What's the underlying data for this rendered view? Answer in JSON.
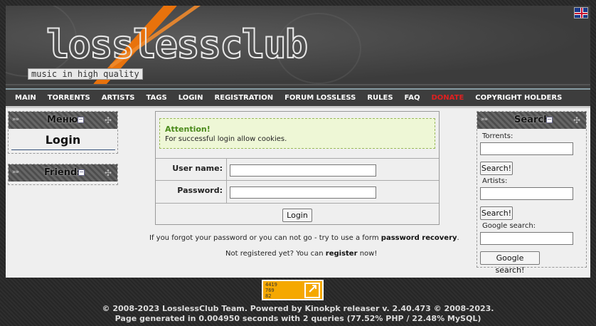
{
  "header": {
    "logo_text": "losslessclub",
    "tagline": "music in high quality"
  },
  "nav": {
    "items": [
      "MAIN",
      "TORRENTS",
      "ARTISTS",
      "TAGS",
      "LOGIN",
      "REGISTRATION",
      "FORUM LOSSLESS",
      "RULES",
      "FAQ",
      "DONATE",
      "COPYRIGHT HOLDERS"
    ]
  },
  "sidebar_left": {
    "menu_title": "Меню",
    "login_title": "Login",
    "friends_title": "Friends"
  },
  "login_form": {
    "attention_title": "Attention!",
    "attention_text": "For successful login allow cookies.",
    "username_label": "User name:",
    "password_label": "Password:",
    "login_button": "Login",
    "forgot_text": "If you forgot your password or you can not go - try to use a form ",
    "forgot_link": "password recovery",
    "forgot_end": ".",
    "register_text": "Not registered yet? You can ",
    "register_link": "register",
    "register_end": " now!"
  },
  "search": {
    "title": "Search",
    "torrents_label": "Torrents:",
    "artists_label": "Artists:",
    "google_label": "Google search:",
    "search_button": "Search!",
    "google_button": "Google search!"
  },
  "counter": {
    "line1": "4419",
    "line2": "769",
    "line3": "82"
  },
  "footer": {
    "line1": "© 2008-2023 LosslessClub Team. Powered by Kinokpk releaser v. 2.40.473 © 2008-2023.",
    "line2": "Page generated in 0.004950 seconds with 2 queries (77.52% PHP / 22.48% MySQL)"
  },
  "colors": {
    "accent_orange": "#e8720c",
    "donate_red": "#e02020",
    "attention_green": "#4a8a1a"
  }
}
